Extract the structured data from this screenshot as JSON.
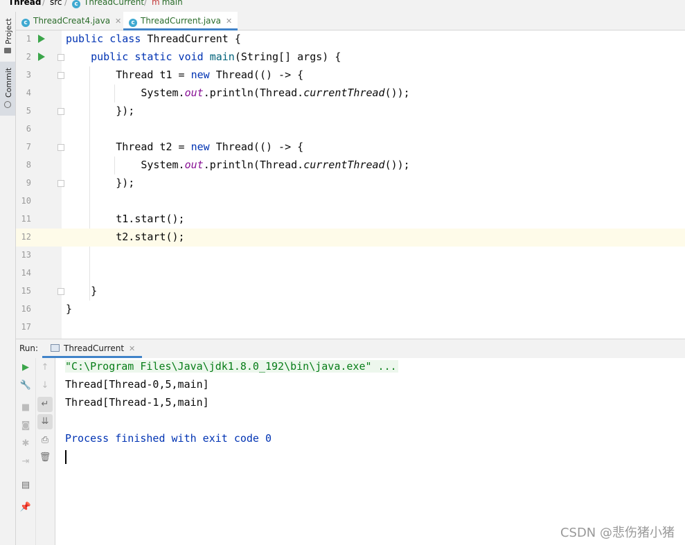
{
  "breadcrumb": [
    "Thread",
    "src",
    "ThreadCurrent",
    "main"
  ],
  "side_tabs": [
    "Project",
    "Commit"
  ],
  "editor_tabs": [
    {
      "label": "ThreadCreat4.java",
      "active": false
    },
    {
      "label": "ThreadCurrent.java",
      "active": true
    }
  ],
  "line_numbers": [
    "1",
    "2",
    "3",
    "4",
    "5",
    "6",
    "7",
    "8",
    "9",
    "10",
    "11",
    "12",
    "13",
    "14",
    "15",
    "16",
    "17"
  ],
  "current_line": 12,
  "run_panel": {
    "title": "Run:",
    "tab_label": "ThreadCurrent",
    "console": {
      "command": "\"C:\\Program Files\\Java\\jdk1.8.0_192\\bin\\java.exe\" ...",
      "output": [
        "Thread[Thread-0,5,main]",
        "Thread[Thread-1,5,main]"
      ],
      "exit_message": "Process finished with exit code 0"
    }
  },
  "watermark": "CSDN @悲伤猪小猪",
  "colors": {
    "keyword": "#0033b3",
    "method": "#00627a",
    "static_field": "#871094",
    "run_green": "#3ba54a",
    "tab_underline": "#4083c9"
  }
}
